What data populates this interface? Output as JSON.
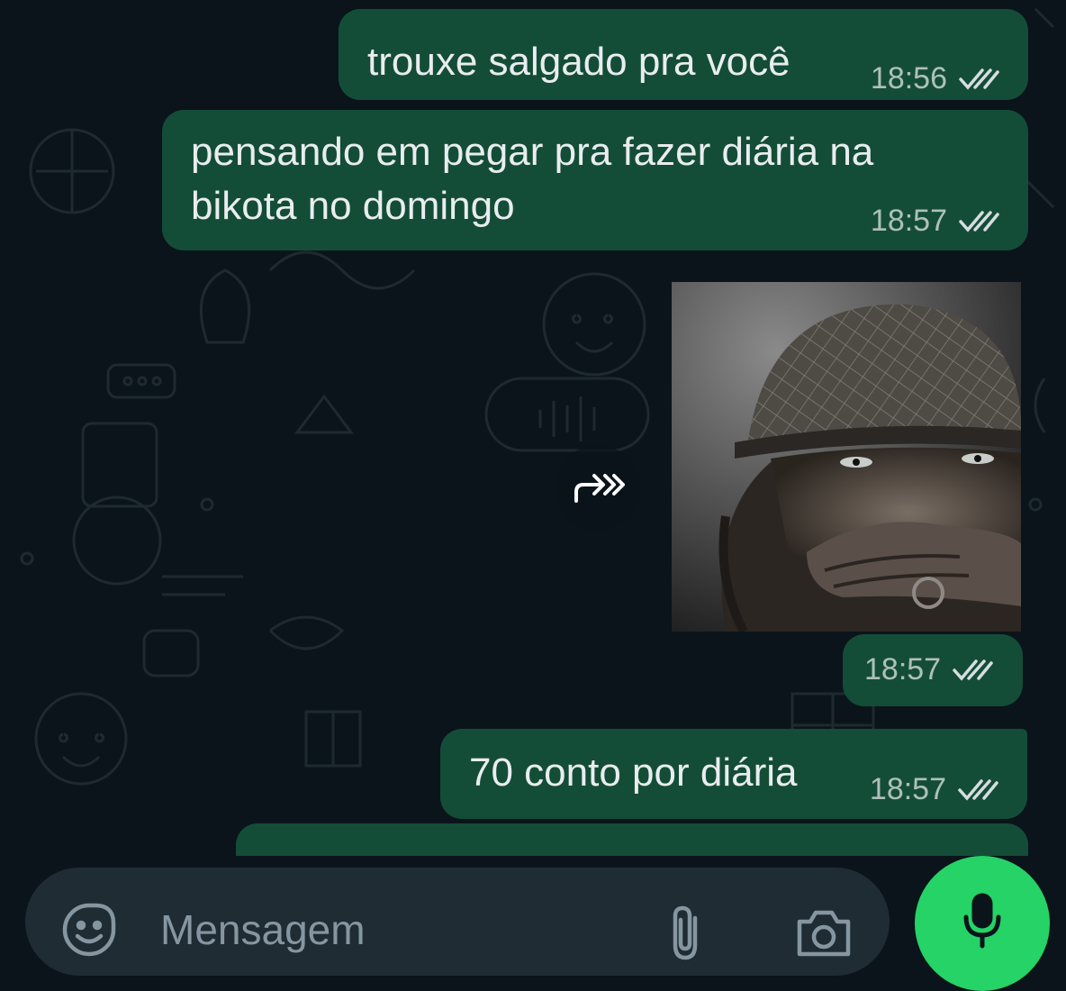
{
  "messages": [
    {
      "text": "trouxe salgado pra você",
      "time": "18:56",
      "status": "read"
    },
    {
      "text": "pensando em pegar pra fazer diária na bikota no domingo",
      "time": "18:57",
      "status": "read"
    },
    {
      "type": "image",
      "description": "soldier with helmet covering mouth",
      "time": "18:57",
      "status": "read"
    },
    {
      "text": "70 conto por diária",
      "time": "18:57",
      "status": "read"
    }
  ],
  "composer": {
    "placeholder": "Mensagem",
    "icons": [
      "emoji-sticker-icon",
      "attach-clip-icon",
      "camera-icon",
      "mic-icon"
    ]
  },
  "colors": {
    "background": "#0b141a",
    "outgoing_bubble": "#144d37",
    "composer_bg": "#1f2c34",
    "mic_button": "#25d366",
    "text": "#e9edef",
    "meta_text": "#8696a0"
  }
}
